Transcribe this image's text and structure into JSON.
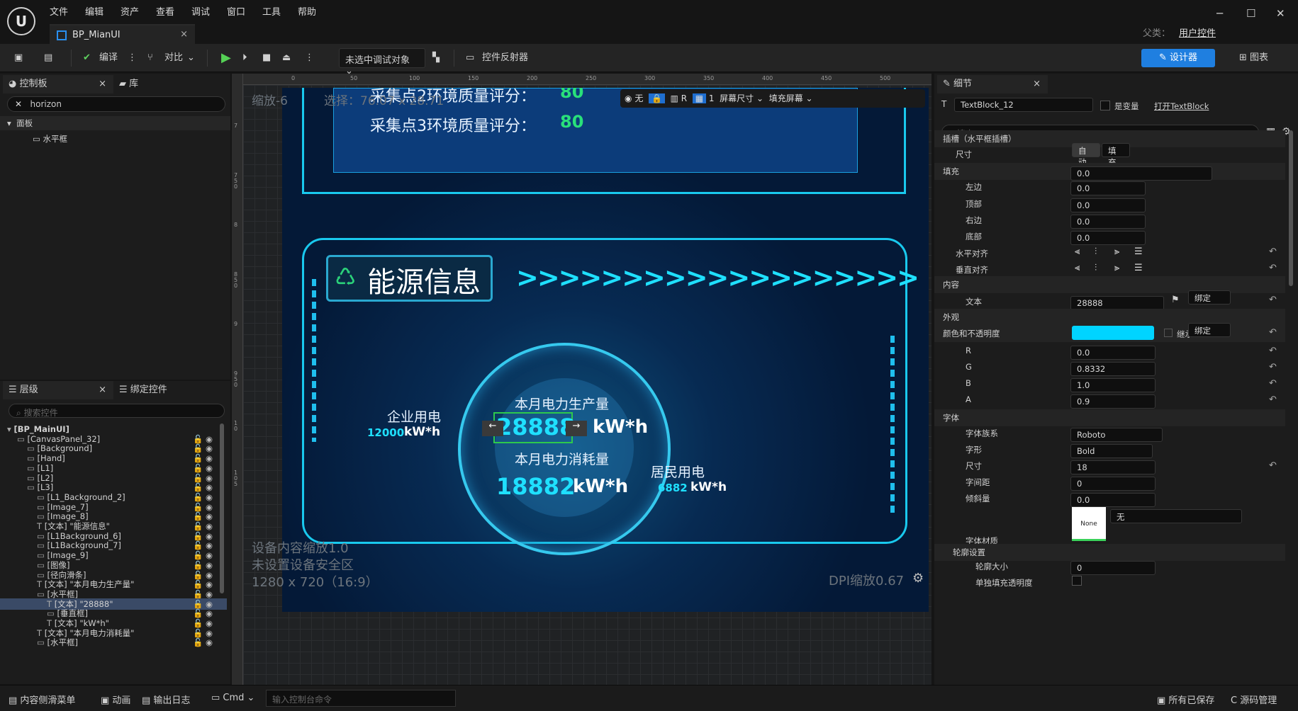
{
  "window": {
    "tab_title": "BP_MianUI",
    "parent_label": "父类：",
    "parent_value": "用户控件"
  },
  "menu": [
    "文件",
    "编辑",
    "资产",
    "查看",
    "调试",
    "窗口",
    "工具",
    "帮助"
  ],
  "toolbar": {
    "compile": "编译",
    "diff": "对比",
    "debug_target": "未选中调试对象",
    "widget_reflector": "控件反射器",
    "designer": "设计器",
    "graph": "图表"
  },
  "palette": {
    "tab": "控制板",
    "lib_tab": "库",
    "search": "horizon",
    "category": "面板",
    "item": "水平框"
  },
  "hierarchy": {
    "tab": "层级",
    "bind_tab": "绑定控件",
    "search_placeholder": "搜索控件",
    "items": [
      "[BP_MainUI]",
      "[CanvasPanel_32]",
      "[Background]",
      "[Hand]",
      "[L1]",
      "[L2]",
      "[L3]",
      "[L1_Background_2]",
      "[Image_7]",
      "[Image_8]",
      "[文本] \"能源信息\"",
      "[L1Background_6]",
      "[L1Background_7]",
      "[Image_9]",
      "[图像]",
      "[径向滑条]",
      "[文本] \"本月电力生产量\"",
      "[水平框]",
      "[文本] \"28888\"",
      "[垂直框]",
      "[文本] \"kW*h\"",
      "[文本] \"本月电力消耗量\"",
      "[水平框]"
    ]
  },
  "canvas": {
    "zoom": "缩放-6",
    "selection": "选择：76.07 x 28.71",
    "device_scale": "设备内容缩放1.0",
    "safe_zone": "未设置设备安全区",
    "resolution": "1280 x 720（16:9）",
    "dpi": "DPI缩放0.67",
    "toolbar": {
      "none": "无",
      "r": "R",
      "grid": "1",
      "screen_size": "屏幕尺寸",
      "fill_screen": "填充屏幕"
    },
    "ruler_h": [
      "0",
      "50",
      "100",
      "150",
      "200",
      "250",
      "300",
      "350",
      "400",
      "450",
      "500",
      "55"
    ],
    "ruler_v": [
      "7",
      "7 5 0",
      "8",
      "8 5 0",
      "9",
      "9 5 0",
      "1 0",
      "1 0 5"
    ]
  },
  "game": {
    "score2": "采集点2环境质量评分：",
    "score2_val": "80",
    "score3": "采集点3环境质量评分：",
    "score3_val": "80",
    "title": "能源信息",
    "arrows": ">>>>>>>>>>>>>>>>>>>",
    "prod_label": "本月电力生产量",
    "prod_val": "28888",
    "unit": "kW*h",
    "cons_label": "本月电力消耗量",
    "cons_val": "18882",
    "ent_label": "企业用电",
    "ent_val": "12000",
    "res_label": "居民用电",
    "res_val": "6882"
  },
  "details": {
    "tab": "细节",
    "name": "TextBlock_12",
    "is_var": "是变量",
    "open": "打开TextBlock",
    "search_placeholder": "搜索",
    "slot": "插槽（水平框插槽）",
    "size": "尺寸",
    "auto": "自动",
    "fill": "填充",
    "padding": "填充",
    "padding_val": "0.0",
    "left": "左边",
    "top": "顶部",
    "right": "右边",
    "bottom": "底部",
    "halign": "水平对齐",
    "valign": "垂直对齐",
    "content": "内容",
    "text": "文本",
    "text_val": "28888",
    "bind": "绑定",
    "appearance": "外观",
    "color": "颜色和不透明度",
    "inherit": "继承",
    "r": "R",
    "r_val": "0.0",
    "g": "G",
    "g_val": "0.8332",
    "b": "B",
    "b_val": "1.0",
    "a": "A",
    "a_val": "0.9",
    "font": "字体",
    "family": "字体族系",
    "family_val": "Roboto",
    "typeface": "字形",
    "typeface_val": "Bold",
    "fsize": "尺寸",
    "fsize_val": "18",
    "spacing": "字间距",
    "spacing_val": "0",
    "skew": "倾斜量",
    "skew_val": "0.0",
    "material": "字体材质",
    "material_val": "无",
    "none_swatch": "None",
    "outline": "轮廓设置",
    "outline_size": "轮廓大小",
    "outline_size_val": "0",
    "sep_opacity": "单独填充透明度",
    "swatch_color": "#00d4ff"
  },
  "status": {
    "drawer": "内容侧滑菜单",
    "anim": "动画",
    "log": "输出日志",
    "cmd": "Cmd",
    "console_placeholder": "输入控制台命令",
    "saved": "所有已保存",
    "source": "C 源码管理"
  }
}
